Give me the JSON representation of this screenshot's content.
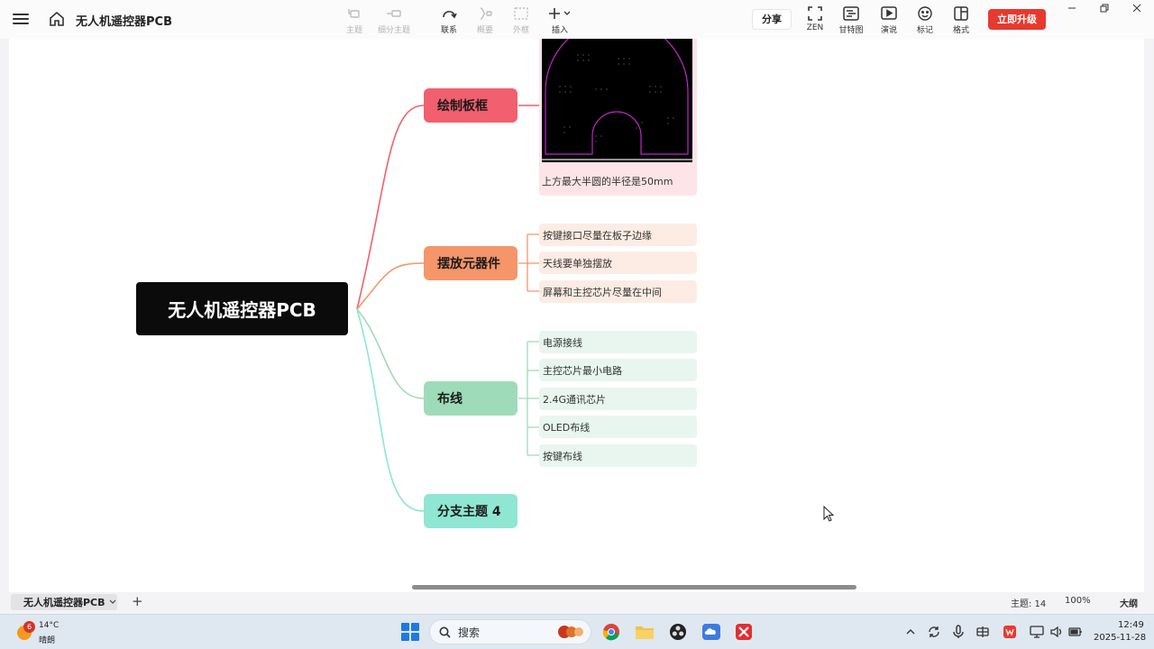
{
  "app": {
    "title": "无人机遥控器PCB"
  },
  "toolbar": {
    "tools": [
      {
        "label": "主题",
        "icon": "topic-icon",
        "enabled": false
      },
      {
        "label": "细分主题",
        "icon": "subtopic-icon",
        "enabled": false
      },
      {
        "label": "联系",
        "icon": "relationship-icon",
        "enabled": true
      },
      {
        "label": "概要",
        "icon": "summary-icon",
        "enabled": false
      },
      {
        "label": "外框",
        "icon": "boundary-icon",
        "enabled": false
      },
      {
        "label": "插入",
        "icon": "insert-plus-icon",
        "enabled": true
      }
    ],
    "share_label": "分享",
    "right_tools": [
      {
        "label": "ZEN",
        "icon": "zen-fullscreen-icon"
      },
      {
        "label": "甘特图",
        "icon": "gantt-icon"
      },
      {
        "label": "演说",
        "icon": "pitch-play-icon"
      },
      {
        "label": "标记",
        "icon": "marker-smiley-icon"
      },
      {
        "label": "格式",
        "icon": "format-panel-icon"
      }
    ],
    "upgrade_label": "立即升级"
  },
  "mindmap": {
    "root": "无人机遥控器PCB",
    "branches": [
      {
        "label": "绘制板框",
        "color": "#f25f6e",
        "image_caption": "上方最大半圆的半径是50mm"
      },
      {
        "label": "摆放元器件",
        "color": "#f5956a",
        "children": [
          "按键接口尽量在板子边缘",
          "天线要单独摆放",
          "屏幕和主控芯片尽量在中间"
        ]
      },
      {
        "label": "布线",
        "color": "#9edbb8",
        "children": [
          "电源接线",
          "主控芯片最小电路",
          "2.4G通讯芯片",
          "OLED布线",
          "按键布线"
        ]
      },
      {
        "label": "分支主题 4",
        "color": "#8fe6d2"
      }
    ]
  },
  "statusbar": {
    "sheet_tab": "无人机遥控器PCB",
    "topic_count": "主题: 14",
    "zoom": "100%",
    "outline": "大纲"
  },
  "taskbar": {
    "weather_badge": "6",
    "temperature": "14°C",
    "condition": "晴朗",
    "search_label": "搜索",
    "time": "12:49",
    "date": "2025-11-28"
  },
  "colors": {
    "accent_red": "#e8392e",
    "root_bg": "#0b0b0b",
    "branch1_light": "#fde4e8",
    "branch2_light": "#fdece4",
    "branch3_light": "#e8f6ef"
  }
}
